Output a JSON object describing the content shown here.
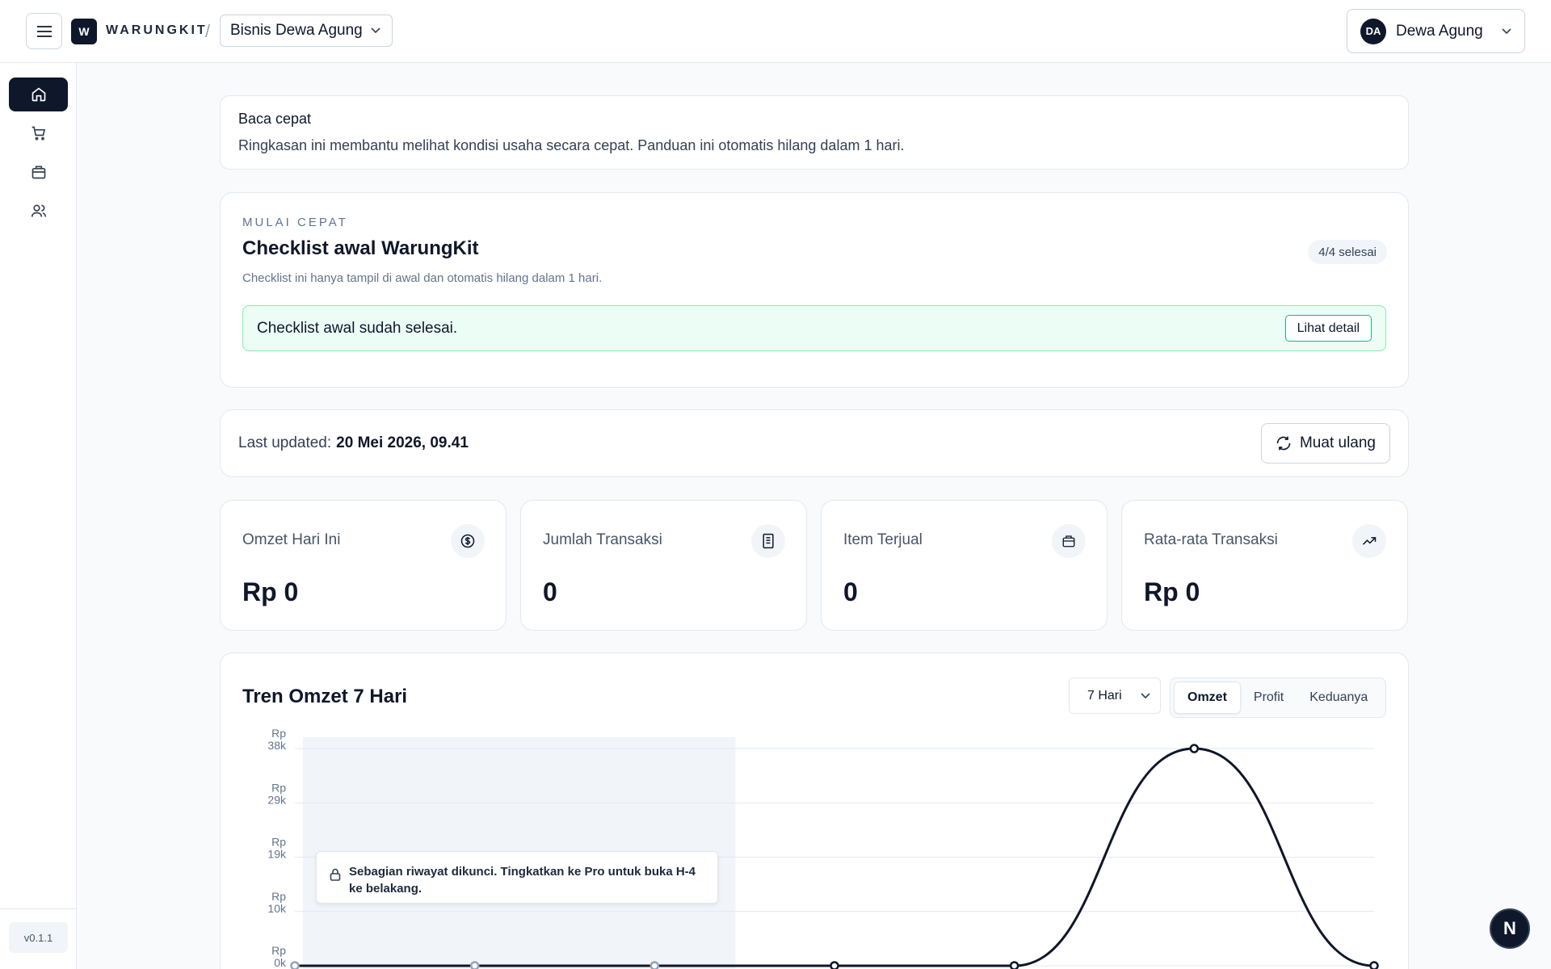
{
  "topbar": {
    "brand_initial": "W",
    "brand_name": "WARUNGKIT",
    "separator": "/",
    "business_name": "Bisnis Dewa Agung",
    "user_initials": "DA",
    "user_name": "Dewa Agung"
  },
  "sidebar": {
    "items": [
      {
        "icon": "home-icon",
        "active": true
      },
      {
        "icon": "cart-icon",
        "active": false
      },
      {
        "icon": "box-icon",
        "active": false
      },
      {
        "icon": "users-icon",
        "active": false
      }
    ],
    "version": "v0.1.1"
  },
  "quick_read": {
    "title": "Baca cepat",
    "description": "Ringkasan ini membantu melihat kondisi usaha secara cepat. Panduan ini otomatis hilang dalam 1 hari."
  },
  "checklist": {
    "eyebrow": "MULAI CEPAT",
    "title": "Checklist awal WarungKit",
    "subtitle": "Checklist ini hanya tampil di awal dan otomatis hilang dalam 1 hari.",
    "badge": "4/4 selesai",
    "done_text": "Checklist awal sudah selesai.",
    "detail_label": "Lihat detail"
  },
  "updated": {
    "label": "Last updated:",
    "value": "20 Mei 2026, 09.41",
    "reload_label": "Muat ulang"
  },
  "stats": [
    {
      "label": "Omzet Hari Ini",
      "value": "Rp 0",
      "icon": "dollar-circle-icon"
    },
    {
      "label": "Jumlah Transaksi",
      "value": "0",
      "icon": "receipt-icon"
    },
    {
      "label": "Item Terjual",
      "value": "0",
      "icon": "bag-icon"
    },
    {
      "label": "Rata-rata Transaksi",
      "value": "Rp 0",
      "icon": "trending-up-icon"
    }
  ],
  "trend": {
    "title": "Tren Omzet 7 Hari",
    "range_selected": "7 Hari",
    "toggles": [
      {
        "label": "Omzet",
        "active": true
      },
      {
        "label": "Profit",
        "active": false
      },
      {
        "label": "Keduanya",
        "active": false
      }
    ],
    "lock_note": "Sebagian riwayat dikunci. Tingkatkan ke Pro untuk buka H-4 ke belakang."
  },
  "colors": {
    "primary": "#0f172a",
    "success_bg": "#ecfdf5",
    "success_border": "#86efac",
    "muted": "#64748b"
  },
  "chart_data": {
    "type": "line",
    "y_tick_labels": [
      "Rp 0k",
      "Rp 10k",
      "Rp 19k",
      "Rp 29k",
      "Rp 38k"
    ],
    "y_ticks": [
      0,
      9500,
      19000,
      28500,
      38000
    ],
    "ylim": [
      0,
      38000
    ],
    "x_index": [
      0,
      1,
      2,
      3,
      4,
      5,
      6
    ],
    "series": [
      {
        "values": [
          0,
          0,
          0,
          0,
          0,
          38000,
          0
        ]
      }
    ],
    "locked_points": 3,
    "grid": true
  }
}
